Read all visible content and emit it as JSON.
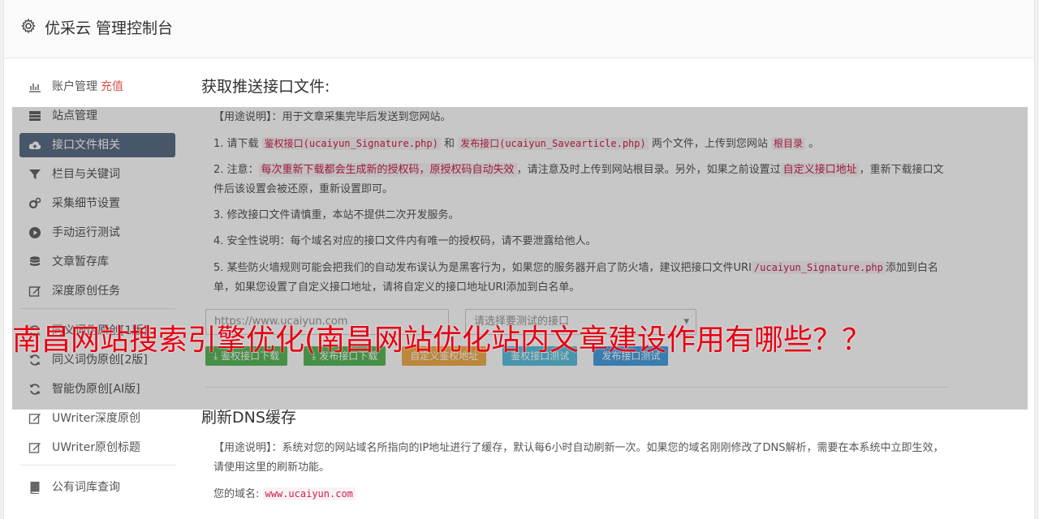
{
  "header": {
    "title": "优采云 管理控制台"
  },
  "sidebar": {
    "items": [
      {
        "label": "账户管理",
        "extra": "充值",
        "icon": "bar-chart-icon"
      },
      {
        "label": "站点管理",
        "icon": "server-icon"
      },
      {
        "label": "接口文件相关",
        "icon": "cloud-upload-icon",
        "active": true
      },
      {
        "label": "栏目与关键词",
        "icon": "filter-icon"
      },
      {
        "label": "采集细节设置",
        "icon": "cogs-icon"
      },
      {
        "label": "手动运行测试",
        "icon": "play-circle-icon"
      },
      {
        "label": "文章暂存库",
        "icon": "database-icon"
      },
      {
        "label": "深度原创任务",
        "icon": "edit-icon"
      }
    ],
    "items2": [
      {
        "label": "同义词伪原创[1版]",
        "icon": "refresh-icon"
      },
      {
        "label": "同义词伪原创[2版]",
        "icon": "refresh-icon"
      },
      {
        "label": "智能伪原创[AI版]",
        "icon": "refresh-icon"
      },
      {
        "label": "UWriter深度原创",
        "icon": "edit-icon"
      },
      {
        "label": "UWriter原创标题",
        "icon": "edit-icon"
      }
    ],
    "items3": [
      {
        "label": "公有词库查询",
        "icon": "book-icon"
      }
    ]
  },
  "section1": {
    "title": "获取推送接口文件:",
    "usage_label": "【用途说明】",
    "usage_text": "：用于文章采集完毕后发送到您网站。",
    "p1_prefix": "1. 请下载 ",
    "p1_code1": "鉴权接口(ucaiyun_Signature.php)",
    "p1_and": " 和 ",
    "p1_code2": "发布接口(ucaiyun_Savearticle.php)",
    "p1_mid": " 两个文件，上传到您网站 ",
    "p1_code3": "根目录",
    "p1_end": " 。",
    "p2_prefix": "2. 注意：",
    "p2_hl1": "每次重新下载都会生成新的授权码，原授权码自动失效",
    "p2_mid": "，请注意及时上传到网站根目录。另外，如果之前设置过",
    "p2_hl2": "自定义接口地址",
    "p2_end": "，重新下载接口文件后该设置会被还原，重新设置即可。",
    "p3": "3. 修改接口文件请慎重，本站不提供二次开发服务。",
    "p4": "4. 安全性说明：每个域名对应的接口文件内有唯一的授权码，请不要泄露给他人。",
    "p5_prefix": "5. 某些防火墙规则可能会把我们的自动发布误认为是黑客行为，如果您的服务器开启了防火墙，建议把接口文件URI",
    "p5_code": "/ucaiyun_Signature.php",
    "p5_end": "添加到白名单，如果您设置了自定义接口地址，请将自定义的接口地址URI添加到白名单。",
    "url_input": "https://www.ucaiyun.com",
    "select_value": "请选择要测试的接口",
    "buttons": [
      "鉴权接口下载",
      "发布接口下载",
      "自定义鉴权地址",
      "鉴权接口测试",
      "发布接口测试"
    ]
  },
  "section2": {
    "title": "刷新DNS缓存",
    "usage_label": "【用途说明】",
    "usage_text": "：系统对您的网站域名所指向的IP地址进行了缓存，默认每6小时自动刷新一次。如果您的域名刚刚修改了DNS解析，需要在本系统中立即生效，请使用这里的刷新功能。",
    "domain_label": "您的域名:",
    "domain_value": "www.ucaiyun.com"
  },
  "banner": {
    "text": "南昌网站搜索引擎优化(南昌网站优化站内文章建设作用有哪些？？"
  }
}
